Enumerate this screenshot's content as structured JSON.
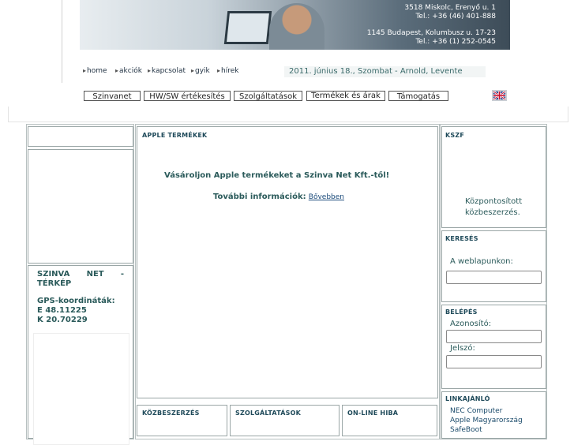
{
  "header": {
    "address1_line1": "3518 Miskolc, Erenyő u. 1",
    "address1_line2": "Tel.: +36 (46) 401-888",
    "address2_line1": "1145 Budapest, Kolumbusz u. 17-23",
    "address2_line2": "Tel.: +36 (1) 252-0545"
  },
  "topmenu": {
    "items": [
      "home",
      "akciók",
      "kapcsolat",
      "gyik",
      "hírek"
    ],
    "date": "2011. június 18., Szombat - Arnold, Levente"
  },
  "nav": {
    "items": [
      "Szinvanet",
      "HW/SW értékesítés",
      "Szolgáltatások",
      "Termékek és árak",
      "Támogatás"
    ],
    "flag_icon": "uk-flag-icon"
  },
  "left": {
    "map_title": "SZINVA NET - TÉRKÉP",
    "gps_label": "GPS-koordináták:",
    "gps_e": "E 48.11225",
    "gps_k": "K 20.70229"
  },
  "center": {
    "title": "APPLE TERMÉKEK",
    "headline": "Vásároljon Apple termékeket a Szinva Net Kft.-től!",
    "more_label": "További információk:",
    "more_link": "Bővebben",
    "bottom_titles": [
      "KÖZBESZERZÉS",
      "SZOLGÁLTATÁSOK",
      "ON-LINE HIBA"
    ]
  },
  "right": {
    "kszf_title": "KSZF",
    "kszf_text1": "Központosított",
    "kszf_text2": "közbeszerzés.",
    "search_title": "KERESÉS",
    "search_label": "A weblapunkon:",
    "login_title": "BELÉPÉS",
    "id_label": "Azonosító:",
    "pw_label": "Jelszó:",
    "links_title": "LINKAJÁNLÓ",
    "links": [
      "NEC Computer",
      "Apple Magyarország",
      "SafeBoot"
    ]
  },
  "colors": {
    "accent": "#1f4f4f",
    "border": "#9aa6a6"
  }
}
